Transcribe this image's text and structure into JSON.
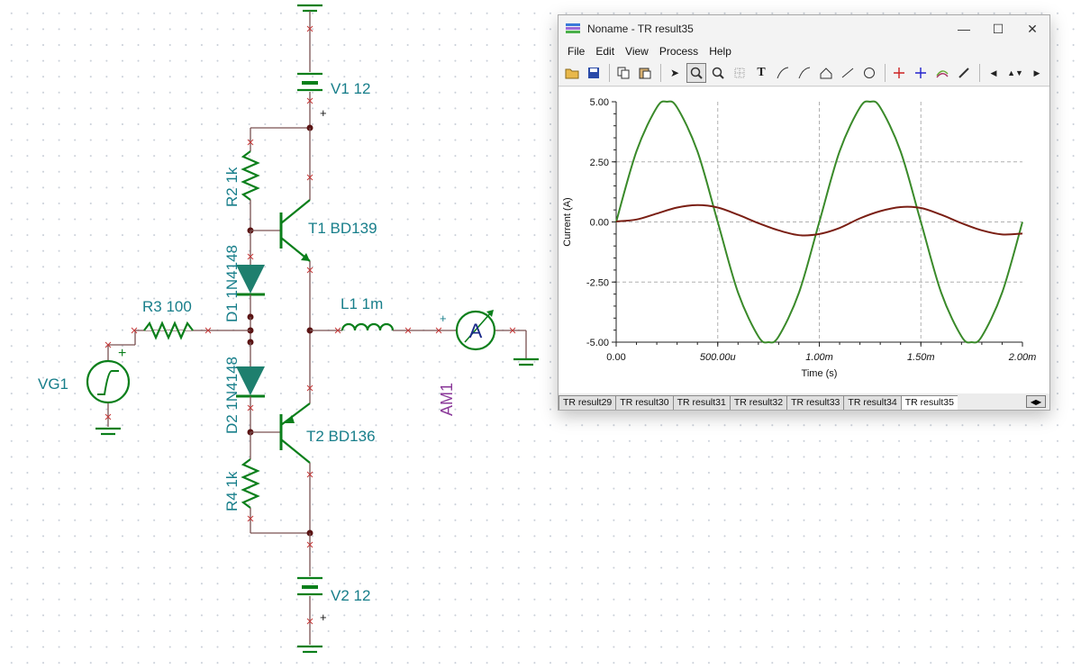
{
  "schematic": {
    "labels": {
      "v1": "V1 12",
      "v2": "V2 12",
      "r2": "R2 1k",
      "r4": "R4 1k",
      "d1": "D1 1N4148",
      "d2": "D2 1N4148",
      "t1": "T1 BD139",
      "t2": "T2 BD136",
      "r3": "R3 100",
      "l1": "L1 1m",
      "vg1": "VG1",
      "am1": "AM1",
      "ammeter_letter": "A",
      "plus": "+"
    },
    "colors": {
      "label": "#177e8a",
      "component": "#0b7f1b",
      "wire": "#7a5050",
      "node": "#5a1414",
      "am1": "#8b3a9a"
    }
  },
  "window": {
    "title": "Noname - TR result35",
    "menu": [
      "File",
      "Edit",
      "View",
      "Process",
      "Help"
    ],
    "toolbar_icons": [
      "open-icon",
      "save-icon",
      "copy-icon",
      "paste-icon",
      "pointer-icon",
      "zoom-in-icon",
      "zoom-100-icon",
      "grid-icon",
      "text-tool-icon",
      "cursor-a-icon",
      "cursor-b-icon",
      "diagram-icon",
      "line-tool-icon",
      "ellipse-tool-icon",
      "marker-a-icon",
      "marker-b-icon",
      "curve-icon",
      "pen-icon",
      "nav-left-icon",
      "nav-updown-icon",
      "nav-right-icon"
    ],
    "tabs": [
      "TR result29",
      "TR result30",
      "TR result31",
      "TR result32",
      "TR result33",
      "TR result34",
      "TR result35"
    ],
    "active_tab": "TR result35"
  },
  "chart_data": {
    "type": "line",
    "xlabel": "Time (s)",
    "ylabel": "Current (A)",
    "xlim": [
      0,
      0.002
    ],
    "ylim": [
      -5,
      5
    ],
    "x_ticks": [
      "0.00",
      "500.00u",
      "1.00m",
      "1.50m",
      "2.00m"
    ],
    "y_ticks": [
      "5.00",
      "2.50",
      "0.00",
      "-2.50",
      "-5.00"
    ],
    "grid": true,
    "series": [
      {
        "color": "#3a8a2a",
        "x": [
          0,
          0.0001,
          0.0002,
          0.00025,
          0.0003,
          0.0004,
          0.0005,
          0.0006,
          0.0007,
          0.00075,
          0.0008,
          0.0009,
          0.001,
          0.0011,
          0.0012,
          0.00125,
          0.0013,
          0.0014,
          0.0015,
          0.0016,
          0.0017,
          0.00175,
          0.0018,
          0.0019,
          0.002
        ],
        "y": [
          0,
          2.94,
          4.76,
          5.0,
          4.76,
          2.94,
          0,
          -2.94,
          -4.76,
          -5.0,
          -4.76,
          -2.94,
          0,
          2.94,
          4.76,
          5.0,
          4.76,
          2.94,
          0,
          -2.94,
          -4.76,
          -5.0,
          -4.76,
          -2.94,
          0
        ]
      },
      {
        "color": "#7a1f14",
        "x": [
          0,
          0.0001,
          0.0002,
          0.0003,
          0.0004,
          0.0005,
          0.0006,
          0.0007,
          0.0008,
          0.0009,
          0.001,
          0.0011,
          0.0012,
          0.0013,
          0.0014,
          0.0015,
          0.0016,
          0.0017,
          0.0018,
          0.0019,
          0.002
        ],
        "y": [
          0.02,
          0.1,
          0.35,
          0.6,
          0.7,
          0.6,
          0.3,
          -0.05,
          -0.35,
          -0.55,
          -0.5,
          -0.25,
          0.15,
          0.45,
          0.62,
          0.58,
          0.3,
          -0.05,
          -0.35,
          -0.52,
          -0.48
        ]
      }
    ]
  }
}
